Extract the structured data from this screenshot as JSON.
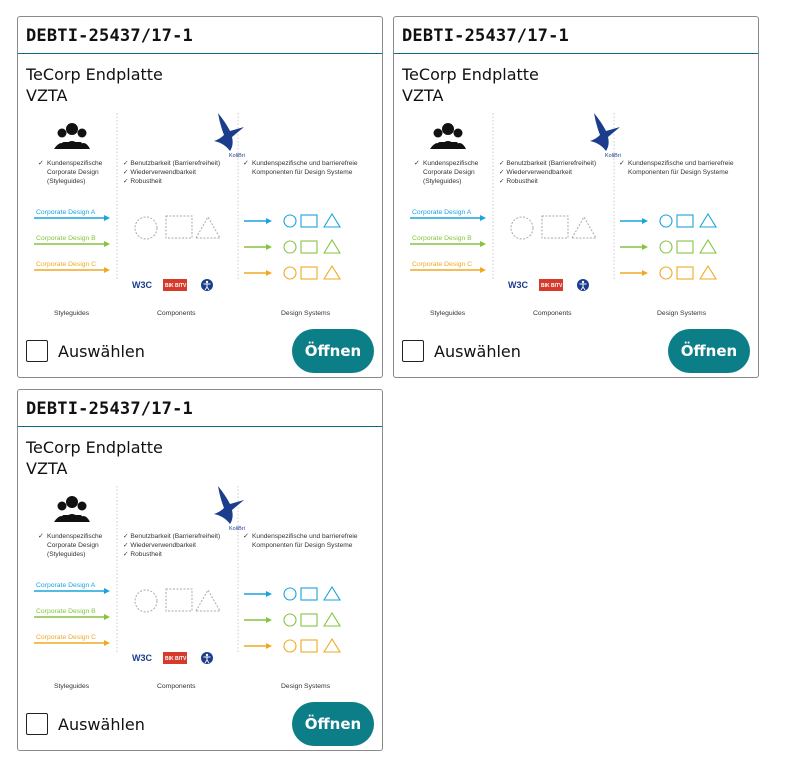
{
  "cards": [
    {
      "id": "DEBTI-25437/17-1",
      "title_line1": "TeCorp Endplatte",
      "title_line2": "VZTA",
      "select_label": "Auswählen",
      "open_label": "Öffnen"
    },
    {
      "id": "DEBTI-25437/17-1",
      "title_line1": "TeCorp Endplatte",
      "title_line2": "VZTA",
      "select_label": "Auswählen",
      "open_label": "Öffnen"
    },
    {
      "id": "DEBTI-25437/17-1",
      "title_line1": "TeCorp Endplatte",
      "title_line2": "VZTA",
      "select_label": "Auswählen",
      "open_label": "Öffnen"
    }
  ],
  "preview": {
    "logo_text": "KoliBri",
    "col1_check": [
      "Kundenspezifische",
      "Corporate Design",
      "(Styleguides)"
    ],
    "col2_checks": [
      "Benutzbarkeit (Barrierefreiheit)",
      "Wiederverwendbarkeit",
      "Robustheit"
    ],
    "col3_check": [
      "Kundenspezifische und barrierefreie",
      "Komponenten für Design Systeme"
    ],
    "arrows": [
      "Corporate Design A",
      "Corporate Design B",
      "Corporate Design C"
    ],
    "badges": [
      "W3C",
      "BIK BITV"
    ],
    "captions": [
      "Styleguides",
      "Components",
      "Design Systems"
    ],
    "colors": {
      "blue": "#1aa3de",
      "green": "#86c440",
      "orange": "#f0a823",
      "navy": "#1b3d8c",
      "teal": "#0b7e88"
    }
  }
}
